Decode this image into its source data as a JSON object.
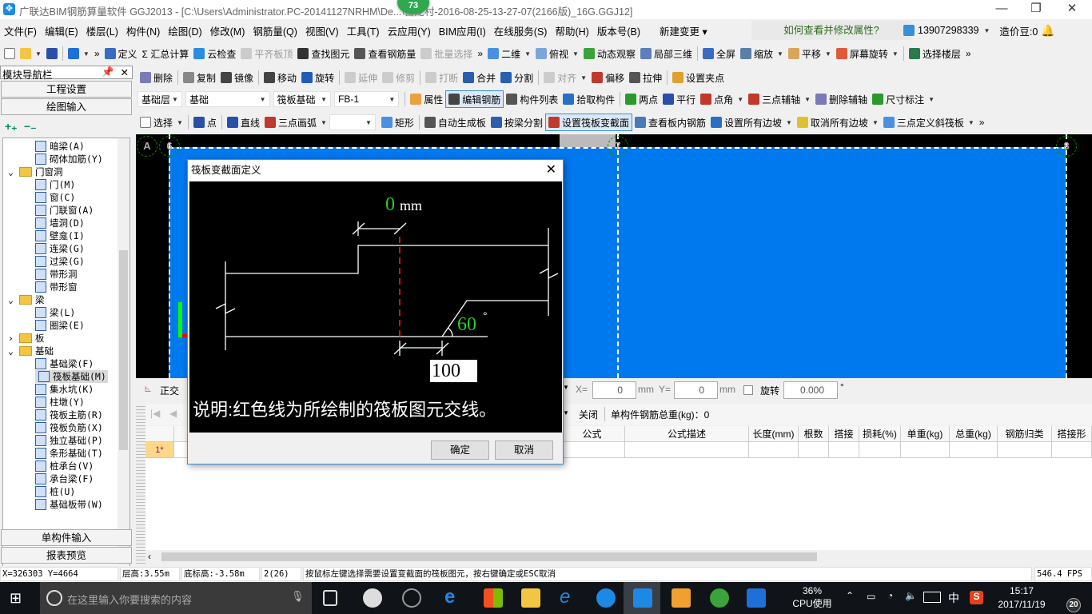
{
  "window": {
    "title": "广联达BIM钢筋算量软件 GGJ2013 - [C:\\Users\\Administrator.PC-20141127NRHM\\De...\\白龙村-2016-08-25-13-27-07(2166版)_16G.GGJ12]",
    "badge": "73",
    "minimize": "—",
    "restore": "❐",
    "close": "✕"
  },
  "menu": [
    "文件(F)",
    "编辑(E)",
    "楼层(L)",
    "构件(N)",
    "绘图(D)",
    "修改(M)",
    "钢筋量(Q)",
    "视图(V)",
    "工具(T)",
    "云应用(Y)",
    "BIM应用(I)",
    "在线服务(S)",
    "帮助(H)",
    "版本号(B)",
    "新建变更 ▾"
  ],
  "help_link": "如何查看并修改属性?",
  "user": {
    "phone": "13907298339",
    "beans": "造价豆:0"
  },
  "toolbar1": [
    {
      "label": "",
      "icon": "new-file",
      "color": "#ffffff"
    },
    {
      "label": "",
      "icon": "open-folder",
      "color": "#f4c542",
      "dd": true
    },
    {
      "label": "",
      "icon": "save",
      "color": "#2a4fa8"
    },
    {
      "sep": true
    },
    {
      "label": "",
      "icon": "undo",
      "color": "#1e6fd9",
      "dd": true
    },
    {
      "label": "»",
      "icon": ""
    },
    {
      "label": "定义",
      "icon": "define",
      "color": "#3a6bc4"
    },
    {
      "label": "Σ 汇总计算",
      "icon": ""
    },
    {
      "label": "云检查",
      "icon": "cloud-check",
      "color": "#2b8de0"
    },
    {
      "label": "平齐板顶",
      "icon": "align-top",
      "color": "#cccccc",
      "dis": true
    },
    {
      "label": "查找图元",
      "icon": "binoculars",
      "color": "#333333"
    },
    {
      "label": "查看钢筋量",
      "icon": "glasses",
      "color": "#555555"
    },
    {
      "label": "批量选择",
      "icon": "batch-select",
      "color": "#cccccc",
      "dis": true
    },
    {
      "label": "»",
      "icon": ""
    },
    {
      "label": "二维",
      "icon": "2d",
      "color": "#4a90e2",
      "dd": true
    },
    {
      "label": "俯视",
      "icon": "top-view",
      "color": "#7aa7d9",
      "dd": true
    },
    {
      "label": "动态观察",
      "icon": "orbit",
      "color": "#3aa33a"
    },
    {
      "label": "局部三维",
      "icon": "local-3d",
      "color": "#5b7fb8"
    },
    {
      "sep": true
    },
    {
      "label": "全屏",
      "icon": "fullscreen",
      "color": "#3a6bc4"
    },
    {
      "label": "缩放",
      "icon": "zoom",
      "color": "#5a7fa8",
      "dd": true
    },
    {
      "label": "平移",
      "icon": "pan",
      "color": "#d9a55a",
      "dd": true
    },
    {
      "label": "屏幕旋转",
      "icon": "rotate-screen",
      "color": "#e05a3a",
      "dd": true
    },
    {
      "sep": true
    },
    {
      "label": "选择楼层",
      "icon": "select-floor",
      "color": "#2a7a4a"
    },
    {
      "label": "»",
      "icon": ""
    }
  ],
  "toolbar2": [
    {
      "label": "删除",
      "icon": "delete",
      "color": "#7a7ab8"
    },
    {
      "sep": true
    },
    {
      "label": "复制",
      "icon": "copy",
      "color": "#888888"
    },
    {
      "label": "镜像",
      "icon": "mirror",
      "color": "#444444"
    },
    {
      "sep": true
    },
    {
      "label": "移动",
      "icon": "move",
      "color": "#444444"
    },
    {
      "label": "旋转",
      "icon": "rotate",
      "color": "#1e5fb5"
    },
    {
      "sep": true
    },
    {
      "label": "延伸",
      "icon": "extend",
      "color": "#cccccc",
      "dis": true
    },
    {
      "label": "修剪",
      "icon": "trim",
      "color": "#cccccc",
      "dis": true
    },
    {
      "sep": true
    },
    {
      "label": "打断",
      "icon": "break",
      "color": "#cccccc",
      "dis": true
    },
    {
      "label": "合并",
      "icon": "merge",
      "color": "#2a5fb0"
    },
    {
      "label": "分割",
      "icon": "split",
      "color": "#2a5fb0"
    },
    {
      "sep": true
    },
    {
      "label": "对齐",
      "icon": "align",
      "color": "#cccccc",
      "dis": true,
      "dd": true
    },
    {
      "label": "偏移",
      "icon": "offset",
      "color": "#c0392b"
    },
    {
      "label": "拉伸",
      "icon": "stretch",
      "color": "#555555"
    },
    {
      "sep": true
    },
    {
      "label": "设置夹点",
      "icon": "grip",
      "color": "#e0a030"
    }
  ],
  "selects": [
    "基础层",
    "基础",
    "筏板基础",
    "FB-1"
  ],
  "toolbar3": [
    {
      "sep": true
    },
    {
      "label": "属性",
      "icon": "properties",
      "color": "#e8a040"
    },
    {
      "label": "编辑钢筋",
      "icon": "edit-rebar",
      "color": "#444444",
      "pressed": true
    },
    {
      "label": "构件列表",
      "icon": "component-list",
      "color": "#555555"
    },
    {
      "label": "拾取构件",
      "icon": "pick",
      "color": "#2a6fc4"
    },
    {
      "sep": true
    },
    {
      "label": "两点",
      "icon": "two-point",
      "color": "#2a9a2a"
    },
    {
      "label": "平行",
      "icon": "parallel",
      "color": "#2a4fa8"
    },
    {
      "label": "点角",
      "icon": "point-angle",
      "color": "#c0392b",
      "dd": true
    },
    {
      "label": "三点辅轴",
      "icon": "three-point-axis",
      "color": "#c0392b",
      "dd": true
    },
    {
      "label": "删除辅轴",
      "icon": "delete-axis",
      "color": "#7a7ab8"
    },
    {
      "label": "尺寸标注",
      "icon": "dimension",
      "color": "#2a9a2a",
      "dd": true
    }
  ],
  "toolbar4": [
    {
      "label": "选择",
      "icon": "pointer",
      "color": "#ffffff",
      "dd": true
    },
    {
      "sep": true
    },
    {
      "label": "点",
      "icon": "point",
      "color": "#2a4fa8"
    },
    {
      "sep": true
    },
    {
      "label": "直线",
      "icon": "line",
      "color": "#2a4fa8"
    },
    {
      "label": "三点画弧",
      "icon": "arc",
      "color": "#c0392b",
      "dd": true
    },
    {
      "label": "",
      "select": true
    },
    {
      "label": "矩形",
      "icon": "rectangle",
      "color": "#4a90e2"
    },
    {
      "sep": true
    },
    {
      "label": "自动生成板",
      "icon": "auto-slab",
      "color": "#555555"
    },
    {
      "label": "按梁分割",
      "icon": "split-by-beam",
      "color": "#2a5fb0"
    },
    {
      "label": "设置筏板变截面",
      "icon": "variable-section",
      "color": "#c0392b",
      "pressed": true
    },
    {
      "label": "查看板内钢筋",
      "icon": "view-slab-rebar",
      "color": "#4a7ab8"
    },
    {
      "label": "设置所有边坡",
      "icon": "set-slopes",
      "color": "#2a6fc4",
      "dd": true
    },
    {
      "label": "取消所有边坡",
      "icon": "cancel-slopes",
      "color": "#e0c030",
      "dd": true
    },
    {
      "label": "三点定义斜筏板",
      "icon": "sloped-raft",
      "color": "#4a90e2",
      "dd": true
    },
    {
      "label": "»",
      "icon": ""
    }
  ],
  "nav": {
    "title": "模块导航栏",
    "pin": "ꟸ",
    "close": "✕",
    "project_settings": "工程设置",
    "drawing_input": "绘图输入",
    "expand": "+₊",
    "collapse": "−₋",
    "single_input": "单构件输入",
    "report_preview": "报表预览",
    "tree": [
      {
        "label": "暗梁(A)",
        "lvl": 2
      },
      {
        "label": "砌体加筋(Y)",
        "lvl": 2
      },
      {
        "label": "门窗洞",
        "lvl": 1,
        "folder": true,
        "open": true
      },
      {
        "label": "门(M)",
        "lvl": 2
      },
      {
        "label": "窗(C)",
        "lvl": 2
      },
      {
        "label": "门联窗(A)",
        "lvl": 2
      },
      {
        "label": "墙洞(D)",
        "lvl": 2
      },
      {
        "label": "壁龛(I)",
        "lvl": 2
      },
      {
        "label": "连梁(G)",
        "lvl": 2
      },
      {
        "label": "过梁(G)",
        "lvl": 2
      },
      {
        "label": "带形洞",
        "lvl": 2
      },
      {
        "label": "带形窗",
        "lvl": 2
      },
      {
        "label": "梁",
        "lvl": 1,
        "folder": true,
        "open": true
      },
      {
        "label": "梁(L)",
        "lvl": 2
      },
      {
        "label": "圈梁(E)",
        "lvl": 2
      },
      {
        "label": "板",
        "lvl": 1,
        "folder": true,
        "open": false
      },
      {
        "label": "基础",
        "lvl": 1,
        "folder": true,
        "open": true
      },
      {
        "label": "基础梁(F)",
        "lvl": 2
      },
      {
        "label": "筏板基础(M)",
        "lvl": 2,
        "selected": true
      },
      {
        "label": "集水坑(K)",
        "lvl": 2
      },
      {
        "label": "柱墩(Y)",
        "lvl": 2
      },
      {
        "label": "筏板主筋(R)",
        "lvl": 2
      },
      {
        "label": "筏板负筋(X)",
        "lvl": 2
      },
      {
        "label": "独立基础(P)",
        "lvl": 2
      },
      {
        "label": "条形基础(T)",
        "lvl": 2
      },
      {
        "label": "桩承台(V)",
        "lvl": 2
      },
      {
        "label": "承台梁(F)",
        "lvl": 2
      },
      {
        "label": "桩(U)",
        "lvl": 2
      },
      {
        "label": "基础板带(W)",
        "lvl": 2
      }
    ]
  },
  "canvas": {
    "axes": [
      "A",
      "6",
      "7",
      "8"
    ],
    "colors": {
      "slab": "#0079ef",
      "background": "#000000"
    }
  },
  "lower_toolbar": {
    "ortho": "正交",
    "x_label": "X=",
    "x_value": "0",
    "y_label": "Y=",
    "y_value": "0",
    "unit": "mm",
    "rotate_label": "旋转",
    "rotate_value": "0.000",
    "degree": "°"
  },
  "grid_toolbar": {
    "close": "关闭",
    "total": "单构件钢筋总重(kg)：0"
  },
  "grid": {
    "headers": [
      "公式",
      "公式描述",
      "长度(mm)",
      "根数",
      "搭接",
      "损耗(%)",
      "单重(kg)",
      "总重(kg)",
      "钢筋归类",
      "搭接形"
    ],
    "rows": [
      {
        "num": "1*"
      }
    ]
  },
  "dialog": {
    "title": "筏板变截面定义",
    "offset_value": "0",
    "offset_unit": "mm",
    "angle_value": "60",
    "angle_unit": "°",
    "width_value": "100",
    "note": "说明:红色线为所绘制的筏板图元交线。",
    "ok": "确定",
    "cancel": "取消"
  },
  "status": {
    "coords": "X=326303 Y=4664",
    "floor_height": "层高:3.55m",
    "bottom_elev": "底标高:-3.58m",
    "count": "2(26)",
    "message": "按鼠标左键选择需要设置变截面的筏板图元，按右键确定或ESC取消",
    "fps": "546.4 FPS"
  },
  "taskbar": {
    "search_placeholder": "在这里输入你要搜索的内容",
    "cpu_percent": "36%",
    "cpu_label": "CPU使用",
    "ime": "中",
    "time": "15:17",
    "date": "2017/11/19",
    "notifications": "20"
  }
}
